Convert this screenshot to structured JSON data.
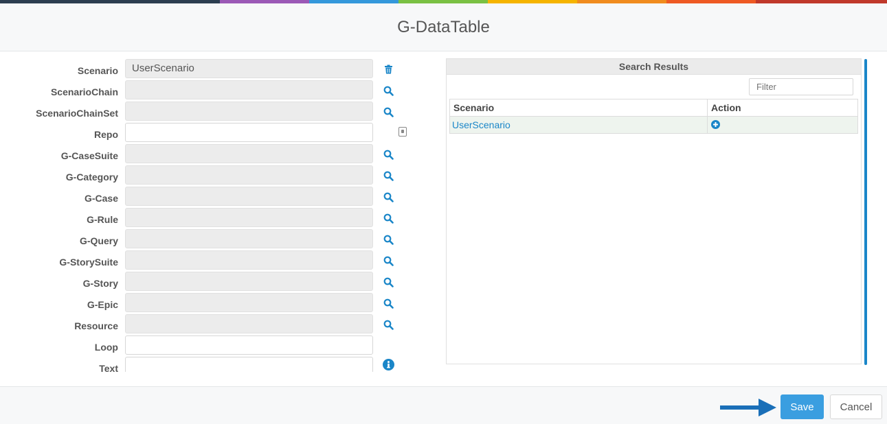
{
  "colors": {
    "top_stripes": [
      "#2c3e50",
      "#2c3e50",
      "#9b59b6",
      "#3498db",
      "#7ac143",
      "#f5b400",
      "#f08c1f",
      "#ee5a24",
      "#c0392b"
    ],
    "accent": "#1a86c8",
    "save_bg": "#3a9ee0",
    "arrow": "#1a6fb8"
  },
  "header": {
    "title": "G-DataTable"
  },
  "form": {
    "fields": [
      {
        "label": "Scenario",
        "value": "UserScenario",
        "action_icon": "trash-icon"
      },
      {
        "label": "ScenarioChain",
        "value": "",
        "action_icon": "search-icon"
      },
      {
        "label": "ScenarioChainSet",
        "value": "",
        "action_icon": "search-icon"
      },
      {
        "label": "Repo",
        "value": "",
        "action_icon": ""
      },
      {
        "label": "G-CaseSuite",
        "value": "",
        "action_icon": "search-icon"
      },
      {
        "label": "G-Category",
        "value": "",
        "action_icon": "search-icon"
      },
      {
        "label": "G-Case",
        "value": "",
        "action_icon": "search-icon"
      },
      {
        "label": "G-Rule",
        "value": "",
        "action_icon": "search-icon"
      },
      {
        "label": "G-Query",
        "value": "",
        "action_icon": "search-icon"
      },
      {
        "label": "G-StorySuite",
        "value": "",
        "action_icon": "search-icon"
      },
      {
        "label": "G-Story",
        "value": "",
        "action_icon": "search-icon"
      },
      {
        "label": "G-Epic",
        "value": "",
        "action_icon": "search-icon"
      },
      {
        "label": "Resource",
        "value": "",
        "action_icon": "search-icon"
      },
      {
        "label": "Loop",
        "value": "",
        "action_icon": ""
      },
      {
        "label": "Text",
        "value": "",
        "action_icon": "info-icon"
      }
    ]
  },
  "results": {
    "title": "Search Results",
    "filter_placeholder": "Filter",
    "columns": [
      "Scenario",
      "Action"
    ],
    "rows": [
      {
        "scenario": "UserScenario",
        "action_icon": "plus-circle-icon"
      }
    ]
  },
  "footer": {
    "save_label": "Save",
    "cancel_label": "Cancel",
    "pointer_icon": "arrow-right-icon"
  }
}
